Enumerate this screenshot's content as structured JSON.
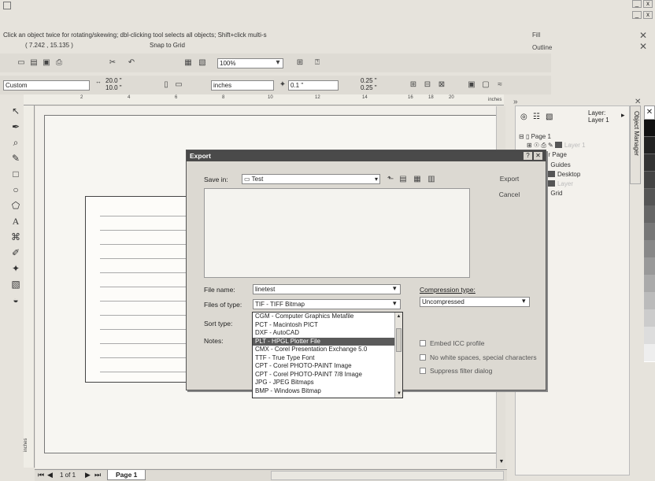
{
  "app": {
    "corner_icon": "document-icon",
    "status_hint": "Click an object twice for rotating/skewing; dbl-clicking tool selects all objects; Shift+click multi-s",
    "coords": "( 7.242 , 15.135 )",
    "snap": "Snap to Grid",
    "fill_label": "Fill",
    "outline_label": "Outline",
    "window_controls": [
      "_",
      "x"
    ]
  },
  "toolbar": {
    "zoom": "100%"
  },
  "propbar": {
    "paper": "Custom",
    "width": "20.0 \"",
    "height": "10.0 \"",
    "units": "inches",
    "nudge": "0.1 \"",
    "dup_x": "0.25 \"",
    "dup_y": "0.25 \""
  },
  "ruler": {
    "ticks": [
      "2",
      "4",
      "6",
      "8",
      "10",
      "12",
      "14",
      "16",
      "18",
      "20"
    ],
    "unit_label": "inches",
    "v_unit": "inches"
  },
  "page_tabs": {
    "counter": "1 of 1",
    "tab_label": "Page 1"
  },
  "docker": {
    "title": "Object Manager",
    "layer_header_label": "Layer:",
    "layer_header_value": "Layer 1",
    "tree": [
      {
        "label": "Page 1"
      },
      {
        "label": "Layer 1"
      },
      {
        "label": "Master Page"
      },
      {
        "label": "Guides"
      },
      {
        "label": "Desktop"
      },
      {
        "label": "Layer"
      },
      {
        "label": "Grid"
      }
    ]
  },
  "dialog": {
    "title": "Export",
    "save_in_label": "Save in:",
    "save_in_value": "Test",
    "export_button": "Export",
    "cancel_button": "Cancel",
    "file_name_label": "File name:",
    "file_name_value": "linetest",
    "files_of_type_label": "Files of type:",
    "files_of_type_value": "TIF - TIFF Bitmap",
    "sort_type_label": "Sort type:",
    "notes_label": "Notes:",
    "compression_label": "Compression type:",
    "compression_value": "Uncompressed",
    "file_types": [
      "CGM - Computer Graphics Metafile",
      "PCT - Macintosh PICT",
      "DXF - AutoCAD",
      "PLT - HPGL Plotter File",
      "CMX - Corel Presentation Exchange 5.0",
      "TTF - True Type Font",
      "CPT - Corel PHOTO-PAINT Image",
      "CPT - Corel PHOTO-PAINT 7/8 Image",
      "JPG - JPEG Bitmaps",
      "BMP - Windows Bitmap"
    ],
    "selected_type": "PLT - HPGL Plotter File",
    "checkboxes": [
      {
        "label": "Embed ICC profile"
      },
      {
        "label": "No white spaces, special characters"
      },
      {
        "label": "Suppress filter dialog"
      }
    ]
  },
  "colors": {
    "workspace": "#e6e3dc",
    "dialog_title": "#4a4a4a",
    "selection": "#5a5a5a"
  }
}
